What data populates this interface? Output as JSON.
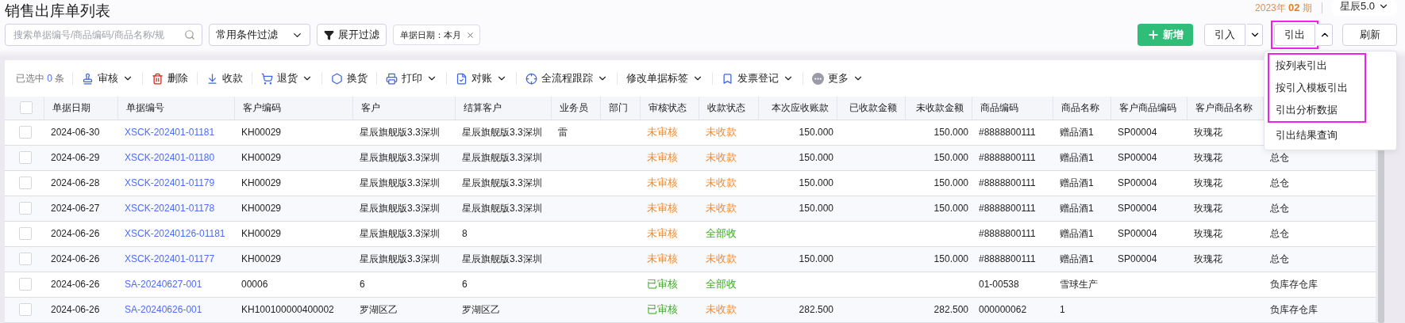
{
  "title": "销售出库单列表",
  "period": {
    "text": "2023年 **02** 期"
  },
  "version_menu": {
    "label": "星辰5.0"
  },
  "filters": {
    "search": {
      "placeholder": "搜索单据编号/商品编码/商品名称/规"
    },
    "preset": {
      "label": "常用条件过滤"
    },
    "expand": {
      "label": "展开过滤"
    },
    "tags": [
      {
        "label": "单据日期：本月"
      }
    ]
  },
  "actions": [
    {
      "kind": "primary",
      "label": "新增"
    },
    {
      "kind": "split",
      "label": "引入",
      "open": false,
      "highlighted": false
    },
    {
      "kind": "split",
      "label": "引出",
      "open": true,
      "highlighted": true
    },
    {
      "kind": "plain",
      "label": "刷新"
    }
  ],
  "export_menu": {
    "items": [
      {
        "label": "按列表引出",
        "highlighted": true
      },
      {
        "label": "按引入模板引出",
        "highlighted": true
      },
      {
        "label": "引出分析数据",
        "highlighted": true
      },
      {
        "label": "引出结果查询",
        "highlighted": false
      }
    ]
  },
  "selection": {
    "prefix": "已选中",
    "count": "0",
    "suffix": "条"
  },
  "toolbar": [
    {
      "label": "审核",
      "menu": true
    },
    {
      "label": "删除",
      "menu": false
    },
    {
      "label": "收款",
      "menu": false
    },
    {
      "label": "退货",
      "menu": true
    },
    {
      "label": "换货",
      "menu": false
    },
    {
      "label": "打印",
      "menu": true
    },
    {
      "label": "对账",
      "menu": true
    },
    {
      "label": "全流程跟踪",
      "menu": true
    },
    {
      "label": "修改单据标签",
      "menu": true
    },
    {
      "label": "发票登记",
      "menu": true
    },
    {
      "label": "更多",
      "menu": true
    }
  ],
  "table": {
    "all_checked": false,
    "columns": [
      {
        "label": "单据日期",
        "kind": "text"
      },
      {
        "label": "单据编号",
        "kind": "link"
      },
      {
        "label": "客户编码",
        "kind": "text"
      },
      {
        "label": "客户",
        "kind": "text"
      },
      {
        "label": "结算客户",
        "kind": "text"
      },
      {
        "label": "业务员",
        "kind": "text"
      },
      {
        "label": "部门",
        "kind": "text"
      },
      {
        "label": "审核状态",
        "kind": "status"
      },
      {
        "label": "收款状态",
        "kind": "status"
      },
      {
        "label": "本次应收账款",
        "kind": "amount"
      },
      {
        "label": "已收款金额",
        "kind": "amount"
      },
      {
        "label": "未收款金额",
        "kind": "amount"
      },
      {
        "label": "商品编码",
        "kind": "text"
      },
      {
        "label": "商品名称",
        "kind": "text"
      },
      {
        "label": "客户商品编码",
        "kind": "text"
      },
      {
        "label": "客户商品名称",
        "kind": "text"
      },
      {
        "kind": "text"
      }
    ],
    "rows": [
      {
        "checked": false,
        "cells": [
          "2024-06-30",
          "XSCK-202401-01181",
          "KH00029",
          "星辰旗舰版3.3深圳",
          "星辰旗舰版3.3深圳",
          "雷",
          null,
          {
            "text": "未审核",
            "color": "#f5892b"
          },
          {
            "text": "未收款",
            "color": "#f5892b"
          },
          "150.000",
          null,
          "150.000",
          "#8888800111",
          "赠品酒1",
          "SP00004",
          "玫瑰花",
          null
        ]
      },
      {
        "checked": false,
        "cells": [
          "2024-06-29",
          "XSCK-202401-01180",
          "KH00029",
          "星辰旗舰版3.3深圳",
          "星辰旗舰版3.3深圳",
          null,
          null,
          {
            "text": "未审核",
            "color": "#f5892b"
          },
          {
            "text": "未收款",
            "color": "#f5892b"
          },
          "150.000",
          null,
          "150.000",
          "#8888800111",
          "赠品酒1",
          "SP00004",
          "玫瑰花",
          "总仓"
        ]
      },
      {
        "checked": false,
        "cells": [
          "2024-06-28",
          "XSCK-202401-01179",
          "KH00029",
          "星辰旗舰版3.3深圳",
          "星辰旗舰版3.3深圳",
          null,
          null,
          {
            "text": "未审核",
            "color": "#f5892b"
          },
          {
            "text": "未收款",
            "color": "#f5892b"
          },
          "150.000",
          null,
          "150.000",
          "#8888800111",
          "赠品酒1",
          "SP00004",
          "玫瑰花",
          "总仓"
        ]
      },
      {
        "checked": false,
        "cells": [
          "2024-06-27",
          "XSCK-202401-01178",
          "KH00029",
          "星辰旗舰版3.3深圳",
          "星辰旗舰版3.3深圳",
          null,
          null,
          {
            "text": "未审核",
            "color": "#f5892b"
          },
          {
            "text": "未收款",
            "color": "#f5892b"
          },
          "150.000",
          null,
          "150.000",
          "#8888800111",
          "赠品酒1",
          "SP00004",
          "玫瑰花",
          "总仓"
        ]
      },
      {
        "checked": false,
        "cells": [
          "2024-06-26",
          "XSCK-20240126-01181",
          "KH00029",
          "星辰旗舰版3.3深圳",
          "8",
          null,
          null,
          {
            "text": "未审核",
            "color": "#f5892b"
          },
          {
            "text": "全部收",
            "color": "#3da821"
          },
          null,
          null,
          null,
          "#8888800111",
          "赠品酒1",
          "SP00004",
          "玫瑰花",
          "总仓"
        ]
      },
      {
        "checked": false,
        "cells": [
          "2024-06-26",
          "XSCK-202401-01177",
          "KH00029",
          "星辰旗舰版3.3深圳",
          "星辰旗舰版3.3深圳",
          null,
          null,
          {
            "text": "未审核",
            "color": "#f5892b"
          },
          {
            "text": "未收款",
            "color": "#f5892b"
          },
          "150.000",
          null,
          "150.000",
          "#8888800111",
          "赠品酒1",
          "SP00004",
          "玫瑰花",
          "总仓"
        ]
      },
      {
        "checked": false,
        "cells": [
          "2024-06-26",
          "SA-20240627-001",
          "00006",
          "6",
          "6",
          null,
          null,
          {
            "text": "已审核",
            "color": "#3da821"
          },
          {
            "text": "全部收",
            "color": "#3da821"
          },
          null,
          null,
          null,
          "01-00538",
          "雪球生产",
          null,
          null,
          "负库存仓库"
        ]
      },
      {
        "checked": false,
        "cells": [
          "2024-06-26",
          "SA-20240626-001",
          "KH100100000400002",
          "罗湖区乙",
          "罗湖区乙",
          null,
          null,
          {
            "text": "已审核",
            "color": "#3da821"
          },
          {
            "text": "未收款",
            "color": "#f5892b"
          },
          "282.500",
          null,
          "282.500",
          "000000062",
          "1",
          null,
          null,
          "负库存仓库"
        ]
      }
    ]
  }
}
